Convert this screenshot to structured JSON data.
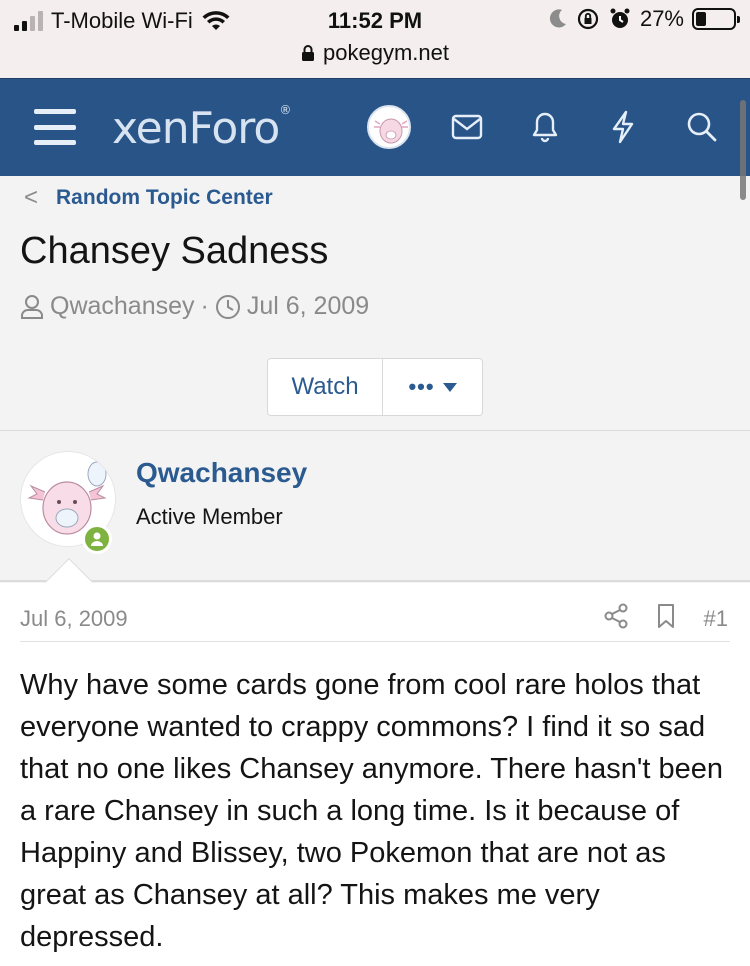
{
  "status_bar": {
    "carrier": "T-Mobile Wi-Fi",
    "time": "11:52 PM",
    "battery": "27%",
    "battery_level": 0.27,
    "url": "pokegym.net"
  },
  "header": {
    "logo": "xenForo",
    "icons": [
      "menu-icon",
      "avatar",
      "mail-icon",
      "bell-icon",
      "bolt-icon",
      "search-icon"
    ],
    "background": "#295488"
  },
  "thread": {
    "breadcrumb": "Random Topic Center",
    "title": "Chansey Sadness",
    "author": "Qwachansey",
    "separator": "·",
    "date": "Jul 6, 2009",
    "watch_label": "Watch",
    "more_label": "•••"
  },
  "post": {
    "username": "Qwachansey",
    "user_title": "Active Member",
    "date": "Jul 6, 2009",
    "number": "#1",
    "body": "Why have some cards gone from cool rare holos that everyone wanted to crappy commons? I find it so sad that no one likes Chansey anymore. There hasn't been a rare Chansey in such a long time. Is it because of Happiny and Blissey, two Pokemon that are not as great as Chansey at all? This makes me very depressed."
  },
  "colors": {
    "link": "#2a5a90",
    "online": "#7fb341",
    "muted": "#8a8a8a"
  }
}
